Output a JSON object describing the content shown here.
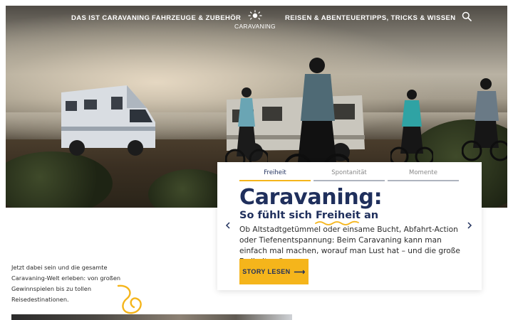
{
  "nav": {
    "links": [
      "DAS IST CARAVANING",
      "FAHRZEUGE & ZUBEHÖR",
      "REISEN & ABENTEUER",
      "TIPPS, TRICKS & WISSEN"
    ],
    "logo_text": "CARAVANING",
    "search_icon": "search-icon"
  },
  "story": {
    "tabs": [
      "Freiheit",
      "Spontanität",
      "Momente"
    ],
    "active_tab": "Freiheit",
    "title": "Caravaning:",
    "subtitle_prefix": "So fühlt sich",
    "subtitle_highlight": "Freiheit",
    "subtitle_suffix": "an",
    "text": "Ob Altstadtgetümmel oder einsame Bucht, Abfahrt-Action oder Tiefenentspannung: Beim Caravaning kann man einfach mal machen, worauf man Lust hat – und die große Freiheit spüren.",
    "cta_label": "STORY LESEN",
    "cta_arrow": "⟶",
    "prev_icon": "chevron-left-icon",
    "next_icon": "chevron-right-icon"
  },
  "teaser": {
    "text": "Jetzt dabei sein und die gesamte Caravaning-Welt erleben: von großen Gewinnspielen bis zu tollen Reisedestinationen."
  },
  "colors": {
    "brand_navy": "#1f2f5c",
    "accent_yellow": "#f5b51b",
    "tab_inactive_line": "#aeb4be"
  }
}
